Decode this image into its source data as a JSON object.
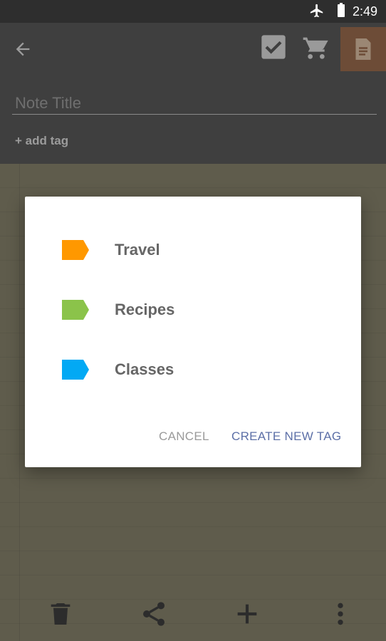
{
  "statusbar": {
    "time": "2:49"
  },
  "note": {
    "title_placeholder": "Note Title",
    "add_tag_label": "+ add tag"
  },
  "dialog": {
    "tags": [
      {
        "label": "Travel",
        "color": "#ff9800"
      },
      {
        "label": "Recipes",
        "color": "#8bc34a"
      },
      {
        "label": "Classes",
        "color": "#03a9f4"
      }
    ],
    "cancel_label": "CANCEL",
    "create_label": "CREATE NEW TAG"
  },
  "icons": {
    "toolbar": [
      "back-arrow-icon",
      "checkbox-icon",
      "cart-icon",
      "note-icon"
    ],
    "bottom": [
      "trash-icon",
      "share-icon",
      "plus-icon",
      "more-icon"
    ]
  },
  "colors": {
    "accent_note": "#6d4c37",
    "dialog_action": "#5c6fa7"
  }
}
